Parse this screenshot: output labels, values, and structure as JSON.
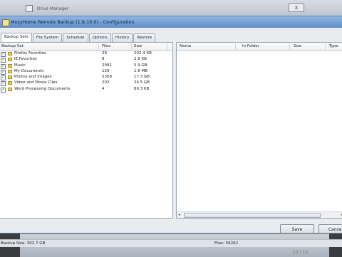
{
  "background_window": {
    "title": "Drive Manager",
    "close_label": "x"
  },
  "dialog": {
    "title": "MozyHome Remote Backup (1.8.10.0) - Configuration"
  },
  "tabs": [
    {
      "label": "Backup Sets",
      "active": true
    },
    {
      "label": "File System",
      "active": false
    },
    {
      "label": "Schedule",
      "active": false
    },
    {
      "label": "Options",
      "active": false
    },
    {
      "label": "History",
      "active": false
    },
    {
      "label": "Restore",
      "active": false
    }
  ],
  "backup_sets": {
    "columns": {
      "name": "Backup Set",
      "files": "Files",
      "size": "Size"
    },
    "rows": [
      {
        "name": "Firefox Favorites",
        "files": "28",
        "size": "202.4 KB",
        "checked": true
      },
      {
        "name": "IE Favorites",
        "files": "8",
        "size": "2.8 KB",
        "checked": true
      },
      {
        "name": "Music",
        "files": "2091",
        "size": "5.9 GB",
        "checked": true
      },
      {
        "name": "My Documents",
        "files": "129",
        "size": "1.6 MB",
        "checked": true
      },
      {
        "name": "Photos and Images",
        "files": "5309",
        "size": "17.3 GB",
        "checked": true
      },
      {
        "name": "Video and Movie Clips",
        "files": "202",
        "size": "24.5 GB",
        "checked": true
      },
      {
        "name": "Word Processing Documents",
        "files": "4",
        "size": "89.3 KB",
        "checked": true
      }
    ]
  },
  "file_list": {
    "columns": {
      "name": "Name",
      "folder": "In Folder",
      "size": "Size",
      "type": "Type"
    }
  },
  "buttons": {
    "save": "Save",
    "cancel": "Cancel"
  },
  "status": {
    "backup_size": "Backup Size: 302.7 GB",
    "files": "Files: 56262"
  },
  "bottom_window": {
    "text": "15 / 13"
  }
}
